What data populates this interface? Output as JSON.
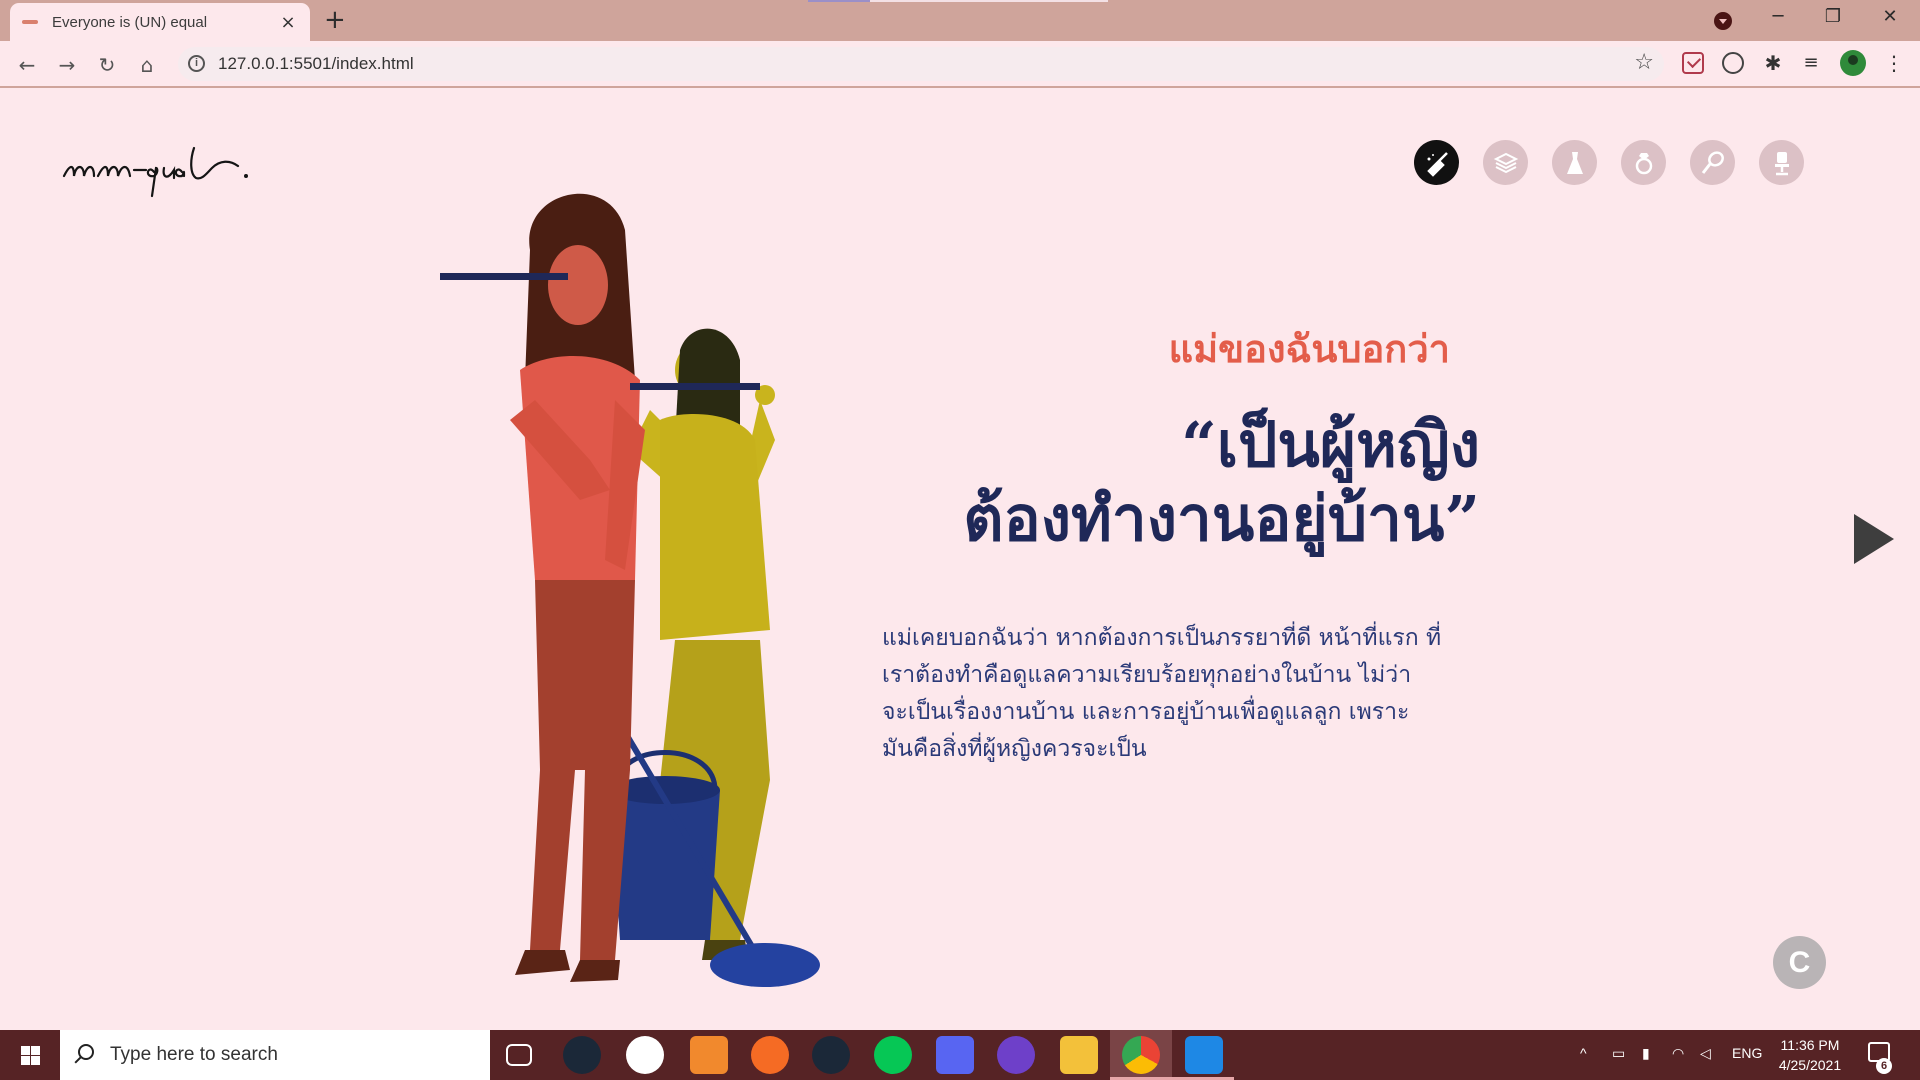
{
  "browser": {
    "tab_title": "Everyone is (UN) equal",
    "tab_close": "×",
    "new_tab": "+",
    "url": "127.0.0.1:5501/index.html",
    "window_controls": {
      "minimize": "─",
      "restore": "❐",
      "close": "✕"
    }
  },
  "page": {
    "logo_text": "un-equal.",
    "categories": [
      {
        "name": "housework",
        "icon": "broom-icon",
        "active": true
      },
      {
        "name": "education",
        "icon": "books-icon",
        "active": false
      },
      {
        "name": "dress",
        "icon": "dress-icon",
        "active": false
      },
      {
        "name": "ring",
        "icon": "ring-icon",
        "active": false
      },
      {
        "name": "sports",
        "icon": "tennis-racket-icon",
        "active": false
      },
      {
        "name": "office",
        "icon": "office-chair-icon",
        "active": false
      }
    ],
    "subtitle": "แม่ของฉันบอกว่า",
    "quote_line1": "“เป็นผู้หญิง",
    "quote_line2": "ต้องทำงานอยู่บ้าน”",
    "body_text": "แม่เคยบอกฉันว่า หากต้องการเป็นภรรยาที่ดี หน้าที่แรก ที่เราต้องทำคือดูแลความเรียบร้อยทุกอย่างในบ้าน ไม่ว่า จะเป็นเรื่องงานบ้าน และการอยู่บ้านเพื่อดูแลลูก เพราะ มันคือสิ่งที่ผู้หญิงควรจะเป็น",
    "corner_badge": "C",
    "colors": {
      "accent": "#e35d4a",
      "navy": "#1f2858",
      "body": "#2b3a78",
      "background": "#fde8ec"
    }
  },
  "taskbar": {
    "search_placeholder": "Type here to search",
    "language": "ENG",
    "time": "11:36 PM",
    "date": "4/25/2021",
    "notifications": "6",
    "apps": [
      "task-view-icon",
      "steam-icon",
      "wacom-icon",
      "sublime-text-icon",
      "origin-icon",
      "steam-icon",
      "line-icon",
      "discord-icon",
      "github-desktop-icon",
      "file-explorer-icon",
      "chrome-icon",
      "vscode-icon"
    ]
  }
}
